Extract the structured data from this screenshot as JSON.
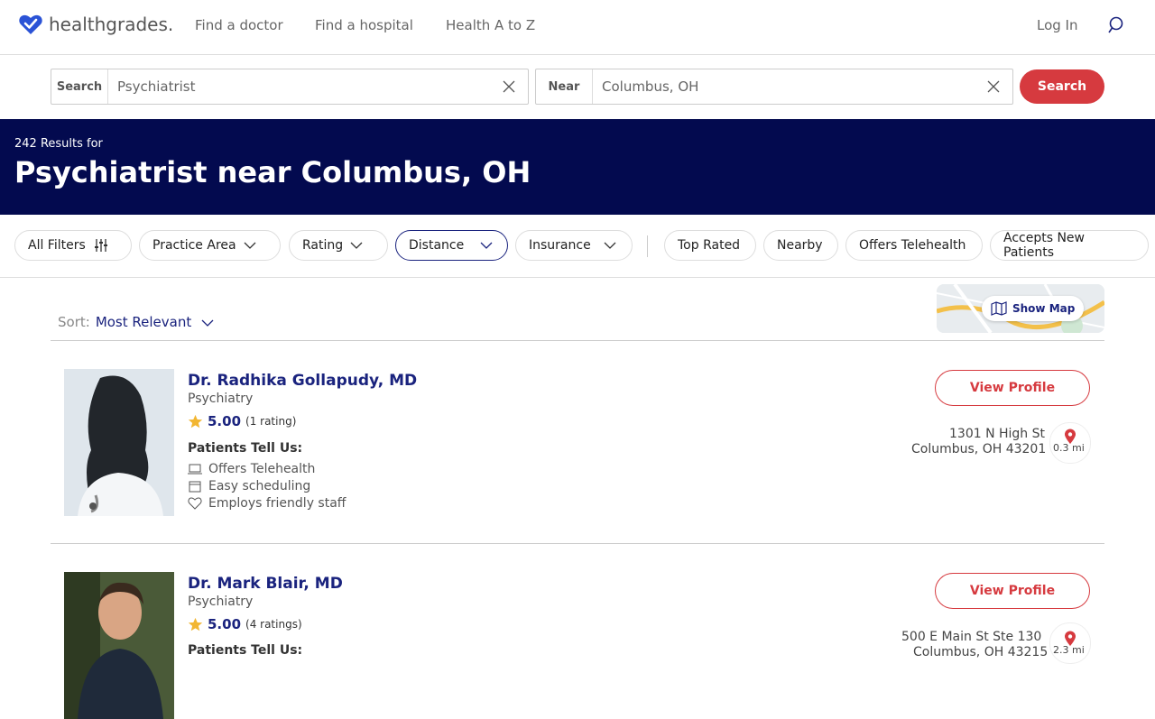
{
  "header": {
    "logo_text": "healthgrades.",
    "nav": [
      "Find a doctor",
      "Find a hospital",
      "Health A to Z"
    ],
    "login": "Log In"
  },
  "search": {
    "what_label": "Search",
    "what_value": "Psychiatrist",
    "near_label": "Near",
    "near_value": "Columbus, OH",
    "button": "Search"
  },
  "hero": {
    "count": "242 Results for",
    "title": "Psychiatrist near Columbus, OH"
  },
  "filters": {
    "all": "All Filters",
    "practice": "Practice Area",
    "rating": "Rating",
    "distance": "Distance",
    "insurance": "Insurance",
    "top_rated": "Top Rated",
    "nearby": "Nearby",
    "telehealth": "Offers Telehealth",
    "new_patients": "Accepts New Patients"
  },
  "sort": {
    "label": "Sort:",
    "value": "Most Relevant"
  },
  "map": {
    "button": "Show Map"
  },
  "results": [
    {
      "name": "Dr. Radhika Gollapudy, MD",
      "specialty": "Psychiatry",
      "rating": "5.00",
      "rating_count": "(1 rating)",
      "patients_tell": "Patients Tell Us:",
      "features": [
        "Offers Telehealth",
        "Easy scheduling",
        "Employs friendly staff"
      ],
      "view_profile": "View Profile",
      "address1": "1301 N High St",
      "address2": "Columbus, OH 43201",
      "distance": "0.3 mi"
    },
    {
      "name": "Dr. Mark Blair, MD",
      "specialty": "Psychiatry",
      "rating": "5.00",
      "rating_count": "(4 ratings)",
      "patients_tell": "Patients Tell Us:",
      "view_profile": "View Profile",
      "address1": "500 E Main St Ste 130",
      "address2": "Columbus, OH 43215",
      "distance": "2.3 mi"
    }
  ],
  "colors": {
    "brand_navy": "#030a4f",
    "accent_red": "#d63a3f",
    "link_blue": "#1a237e"
  }
}
